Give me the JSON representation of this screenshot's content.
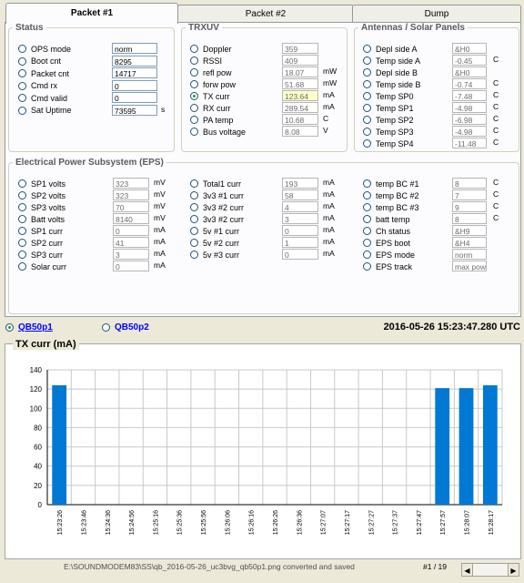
{
  "tabs": [
    "Packet #1",
    "Packet #2",
    "Dump"
  ],
  "status": {
    "title": "Status",
    "rows": [
      {
        "label": "OPS mode",
        "value": "norm",
        "unit": ""
      },
      {
        "label": "Boot cnt",
        "value": "8295",
        "unit": ""
      },
      {
        "label": "Packet cnt",
        "value": "14717",
        "unit": ""
      },
      {
        "label": "Cmd rx",
        "value": "0",
        "unit": ""
      },
      {
        "label": "Cmd valid",
        "value": "0",
        "unit": ""
      },
      {
        "label": "Sat Uptime",
        "value": "73595",
        "unit": "s"
      }
    ]
  },
  "trxuv": {
    "title": "TRXUV",
    "rows": [
      {
        "label": "Doppler",
        "value": "359",
        "unit": ""
      },
      {
        "label": "RSSI",
        "value": "409",
        "unit": ""
      },
      {
        "label": "refl pow",
        "value": "18.07",
        "unit": "mW"
      },
      {
        "label": "forw pow",
        "value": "51.68",
        "unit": "mW"
      },
      {
        "label": "TX curr",
        "value": "123.64",
        "unit": "mA",
        "selected": true
      },
      {
        "label": "RX curr",
        "value": "289.54",
        "unit": "mA"
      },
      {
        "label": "PA temp",
        "value": "10.68",
        "unit": "C"
      },
      {
        "label": "Bus voltage",
        "value": "8.08",
        "unit": "V"
      }
    ]
  },
  "antennas": {
    "title": "Antennas / Solar Panels",
    "rows": [
      {
        "label": "Depl side A",
        "value": "&H0",
        "unit": ""
      },
      {
        "label": "Temp side A",
        "value": "-0.45",
        "unit": "C"
      },
      {
        "label": "Depl side B",
        "value": "&H0",
        "unit": ""
      },
      {
        "label": "Temp side B",
        "value": "-0.74",
        "unit": "C"
      },
      {
        "label": "Temp SP0",
        "value": "-7.48",
        "unit": "C"
      },
      {
        "label": "Temp SP1",
        "value": "-4.98",
        "unit": "C"
      },
      {
        "label": "Temp SP2",
        "value": "-6.98",
        "unit": "C"
      },
      {
        "label": "Temp SP3",
        "value": "-4.98",
        "unit": "C"
      },
      {
        "label": "Temp SP4",
        "value": "-11.48",
        "unit": "C"
      }
    ]
  },
  "eps": {
    "title": "Electrical Power Subsystem (EPS)",
    "col1": [
      {
        "label": "SP1 volts",
        "value": "323",
        "unit": "mV"
      },
      {
        "label": "SP2 volts",
        "value": "323",
        "unit": "mV"
      },
      {
        "label": "SP3 volts",
        "value": "70",
        "unit": "mV"
      },
      {
        "label": "Batt volts",
        "value": "8140",
        "unit": "mV"
      },
      {
        "label": "SP1 curr",
        "value": "0",
        "unit": "mA"
      },
      {
        "label": "SP2 curr",
        "value": "41",
        "unit": "mA"
      },
      {
        "label": "SP3 curr",
        "value": "3",
        "unit": "mA"
      },
      {
        "label": "Solar curr",
        "value": "0",
        "unit": "mA"
      }
    ],
    "col2": [
      {
        "label": "Total1 curr",
        "value": "193",
        "unit": "mA"
      },
      {
        "label": "3v3 #1 curr",
        "value": "58",
        "unit": "mA"
      },
      {
        "label": "3v3 #2 curr",
        "value": "4",
        "unit": "mA"
      },
      {
        "label": "3v3 #2 curr",
        "value": "3",
        "unit": "mA"
      },
      {
        "label": "5v #1 curr",
        "value": "0",
        "unit": "mA"
      },
      {
        "label": "5v #2 curr",
        "value": "1",
        "unit": "mA"
      },
      {
        "label": "5v #3 curr",
        "value": "0",
        "unit": "mA"
      }
    ],
    "col3": [
      {
        "label": "temp BC #1",
        "value": "8",
        "unit": "C"
      },
      {
        "label": "temp BC #2",
        "value": "7",
        "unit": "C"
      },
      {
        "label": "temp BC #3",
        "value": "9",
        "unit": "C"
      },
      {
        "label": "batt temp",
        "value": "8",
        "unit": "C"
      },
      {
        "label": "Ch status",
        "value": "&H9",
        "unit": ""
      },
      {
        "label": "EPS boot",
        "value": "&H4",
        "unit": ""
      },
      {
        "label": "EPS mode",
        "value": "norm",
        "unit": ""
      },
      {
        "label": "EPS track",
        "value": "max pow",
        "unit": ""
      }
    ]
  },
  "satellites": [
    {
      "label": "QB50p1",
      "selected": true
    },
    {
      "label": "QB50p2",
      "selected": false
    }
  ],
  "timestamp": "2016-05-26 15:23:47.280 UTC",
  "chart_data": {
    "type": "bar",
    "title": "TX curr (mA)",
    "ylim": [
      0,
      140
    ],
    "yticks": [
      0,
      20,
      40,
      60,
      80,
      100,
      120,
      140
    ],
    "categories": [
      "15:23:26",
      "15:23:46",
      "15:24:36",
      "15:24:56",
      "15:25:16",
      "15:25:36",
      "15:25:56",
      "15:26:06",
      "15:26:16",
      "15:26:26",
      "15:26:36",
      "15:27:07",
      "15:27:17",
      "15:27:27",
      "15:27:37",
      "15:27:47",
      "15:27:57",
      "15:28:07",
      "15:28:17"
    ],
    "values": [
      124,
      null,
      null,
      null,
      null,
      null,
      null,
      null,
      null,
      null,
      null,
      null,
      null,
      null,
      null,
      null,
      null,
      null,
      null
    ],
    "x_labels": [
      "15:23:26",
      "15:23:46",
      "15:24:36",
      "15:24:56",
      "15:25:16",
      "15:25:36",
      "15:25:56",
      "15:26:06",
      "15:26:16",
      "15:26:26",
      "15:26:36",
      "15:27:07",
      "15:27:17",
      "15:27:27",
      "15:27:37",
      "15:27:47",
      "15:27:57",
      "15:28:07",
      "15:28:17"
    ],
    "bars": [
      {
        "x": "15:23:26",
        "value": 124
      },
      {
        "x": "15:27:57",
        "value": 121
      },
      {
        "x": "15:28:07",
        "value": 121
      },
      {
        "x": "15:28:17",
        "value": 124
      }
    ],
    "bar_color": "#0078d4",
    "grid": true
  },
  "statusbar": {
    "message": "E:\\SOUNDMODEM83\\SS\\qb_2016-05-26_uc3bvg_qb50p1.png converted and saved",
    "page": "#1 / 19"
  }
}
